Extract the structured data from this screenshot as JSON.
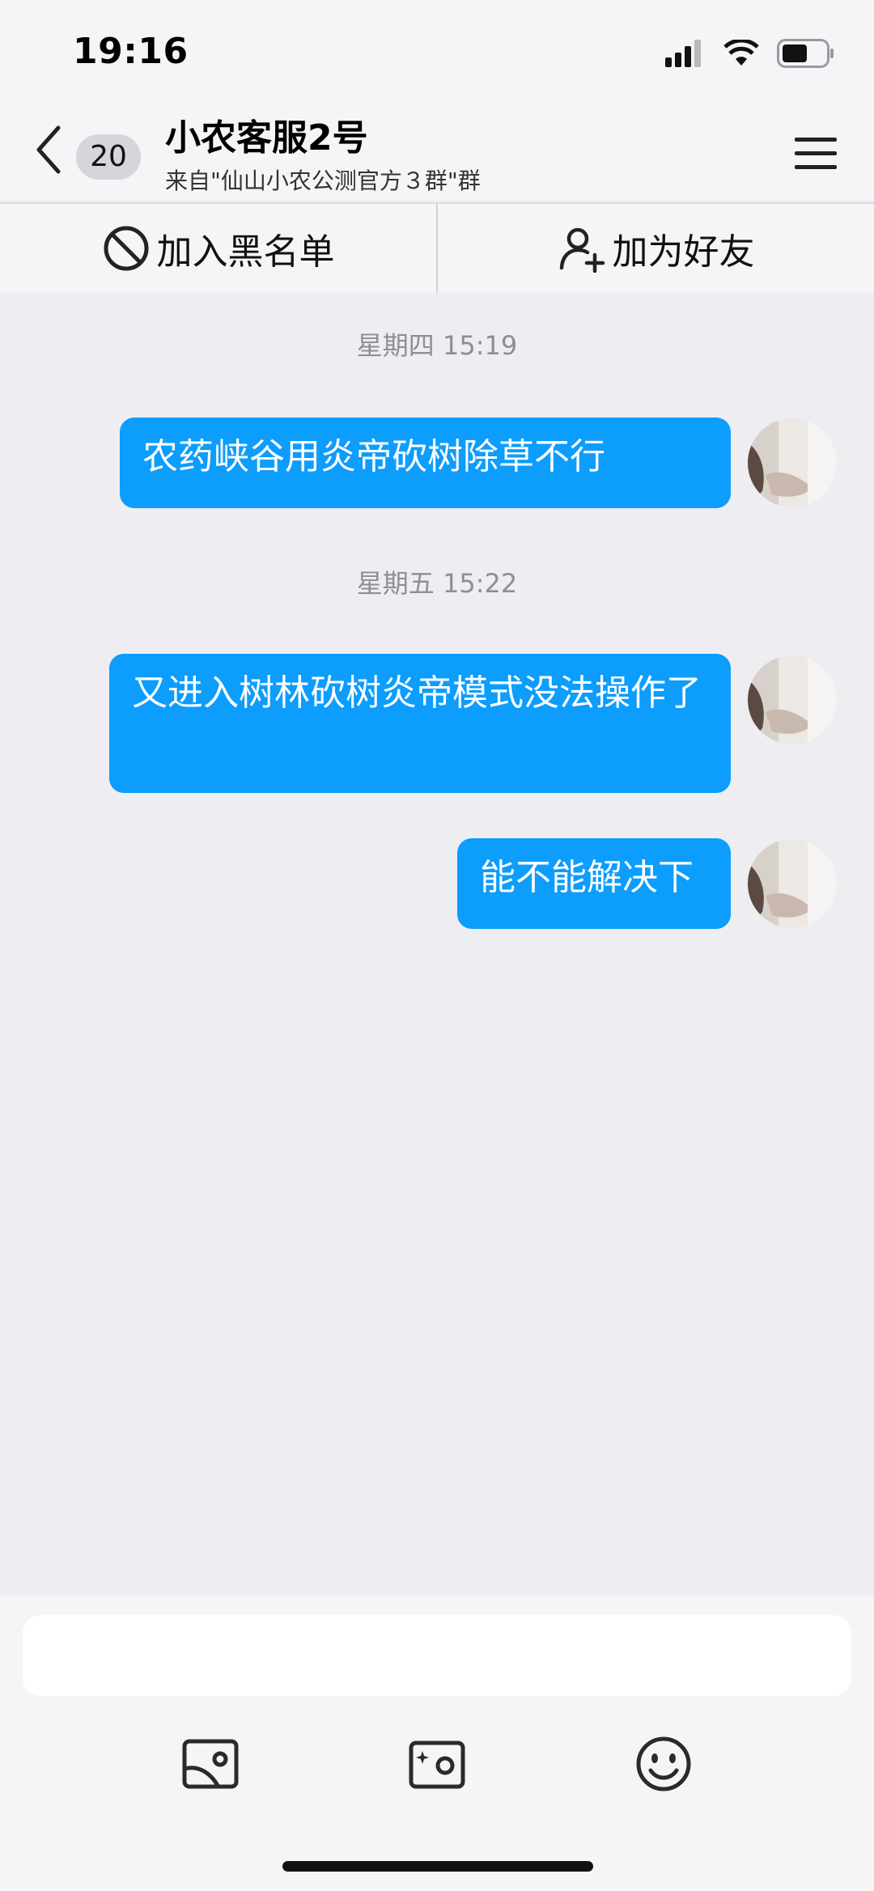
{
  "status_bar": {
    "time": "19:16"
  },
  "header": {
    "unread_count": "20",
    "title": "小农客服2号",
    "subtitle": "来自\"仙山小农公测官方３群\"群"
  },
  "actions": {
    "block": "加入黑名单",
    "add_friend": "加为好友"
  },
  "messages": [
    {
      "timestamp": "星期四 15:19",
      "text": "农药峡谷用炎帝砍树除草不行"
    },
    {
      "timestamp": "星期五 15:22",
      "text": "又进入树林砍树炎帝模式没法操作了"
    },
    {
      "timestamp": "",
      "text": "能不能解决下"
    }
  ],
  "colors": {
    "bubble": "#0c9dfd",
    "background": "#ededf2"
  },
  "icons": [
    "back-icon",
    "menu-icon",
    "block-icon",
    "add-user-icon",
    "image-icon",
    "camera-icon",
    "emoji-icon"
  ]
}
